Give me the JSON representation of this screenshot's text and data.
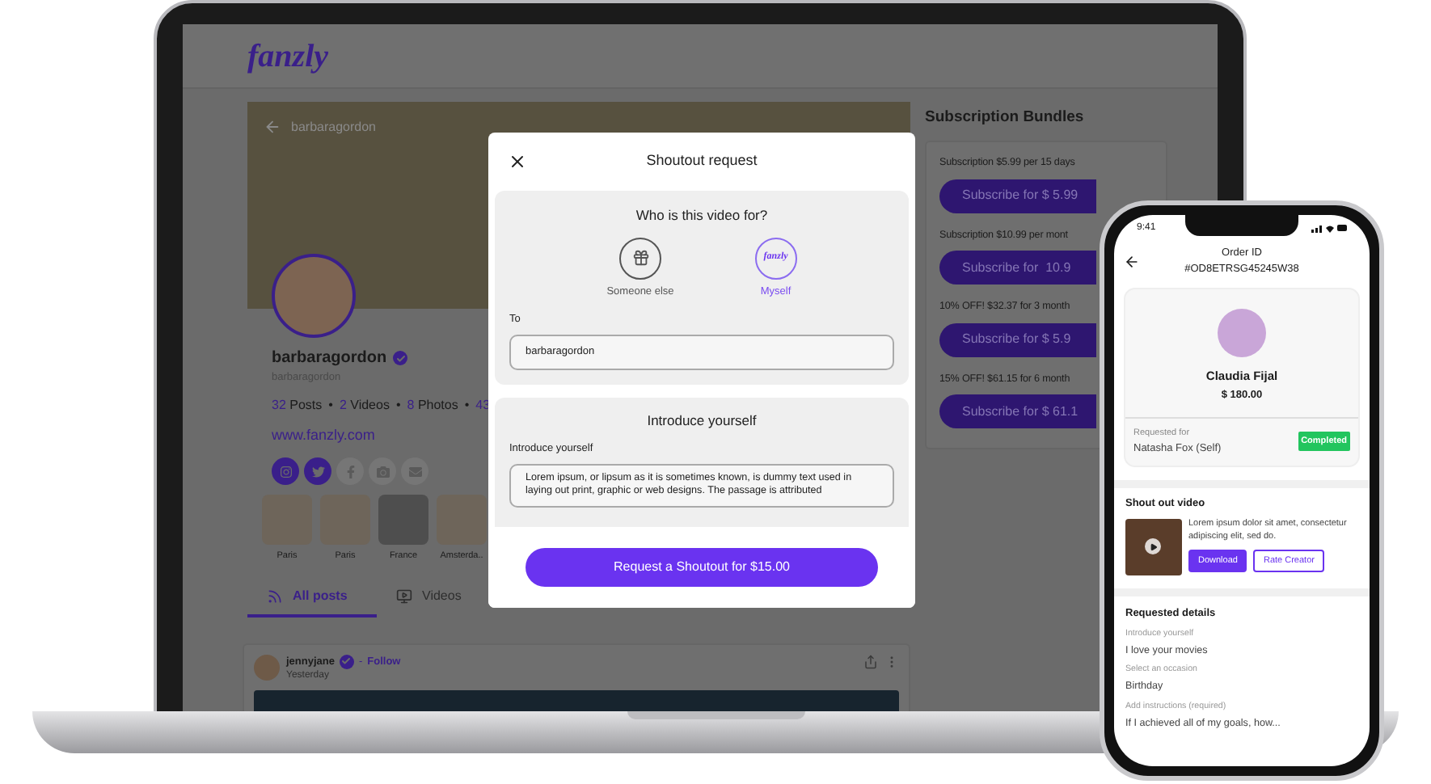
{
  "laptop": {
    "logo": "fanzly",
    "profile": {
      "back_title": "barbaragordon",
      "name": "barbaragordon",
      "handle": "barbaragordon",
      "separator": "•",
      "stats": [
        {
          "count": "32",
          "label": "Posts"
        },
        {
          "count": "2",
          "label": "Videos"
        },
        {
          "count": "8",
          "label": "Photos"
        },
        {
          "count": "43"
        }
      ],
      "website": "www.fanzly.com",
      "socials": [
        {
          "kind": "instagram",
          "active": true
        },
        {
          "kind": "twitter",
          "active": true
        },
        {
          "kind": "facebook",
          "active": false
        },
        {
          "kind": "camera",
          "active": false
        },
        {
          "kind": "mail",
          "active": false
        }
      ],
      "highlights": [
        {
          "label": "Paris"
        },
        {
          "label": "Paris"
        },
        {
          "label": "France"
        },
        {
          "label": "Amsterda.."
        }
      ],
      "tabs": [
        {
          "kind": "feed",
          "label": "All posts",
          "selected": true
        },
        {
          "kind": "video",
          "label": "Videos",
          "selected": false
        }
      ]
    },
    "post": {
      "author": "jennyjane",
      "separator": "-",
      "follow": "Follow",
      "time": "Yesterday"
    },
    "bundles": {
      "title": "Subscription Bundles",
      "items": [
        {
          "description": "Subscription $5.99 per 15 days",
          "button": "Subscribe for $ 5.99"
        },
        {
          "description": "Subscription $10.99 per mont",
          "button": "Subscribe for  10.9"
        },
        {
          "description": "10% OFF! $32.37 for 3 month",
          "button": "Subscribe for $ 5.9"
        },
        {
          "description": "15% OFF! $61.15 for 6 month",
          "button": "Subscribe for $ 61.1"
        }
      ]
    }
  },
  "modal": {
    "title": "Shoutout request",
    "question": "Who is this video for?",
    "options": [
      {
        "kind": "gift",
        "label": "Someone else",
        "selected": false
      },
      {
        "kind": "logo",
        "logo": "fanzly",
        "label": "Myself",
        "selected": true
      }
    ],
    "to_label": "To",
    "to_value": "barbaragordon",
    "section_title": "Introduce yourself",
    "field_label": "Introduce yourself",
    "field_value": "Lorem ipsum, or lipsum as it is sometimes known, is dummy text used in laying out print, graphic or web designs. The passage is attributed",
    "button": "Request a Shoutout for $15.00"
  },
  "phone": {
    "time": "9:41",
    "order_label": "Order ID",
    "order_id": "#OD8ETRSG45245W38",
    "creator": "Claudia Fijal",
    "amount": "$ 180.00",
    "requested_for_label": "Requested for",
    "requested_for": "Natasha Fox (Self)",
    "status": "Completed",
    "video_title": "Shout out video",
    "video_description": "Lorem ipsum dolor sit amet, consectetur adipiscing elit, sed do.",
    "buttons": [
      "Download",
      "Rate Creator"
    ],
    "details_title": "Requested details",
    "details": [
      {
        "label": "Introduce yourself",
        "value": "I love your movies"
      },
      {
        "label": "Select an occasion",
        "value": "Birthday"
      },
      {
        "label": "Add instructions (required)",
        "value": "If I achieved all of my goals, how..."
      }
    ]
  }
}
